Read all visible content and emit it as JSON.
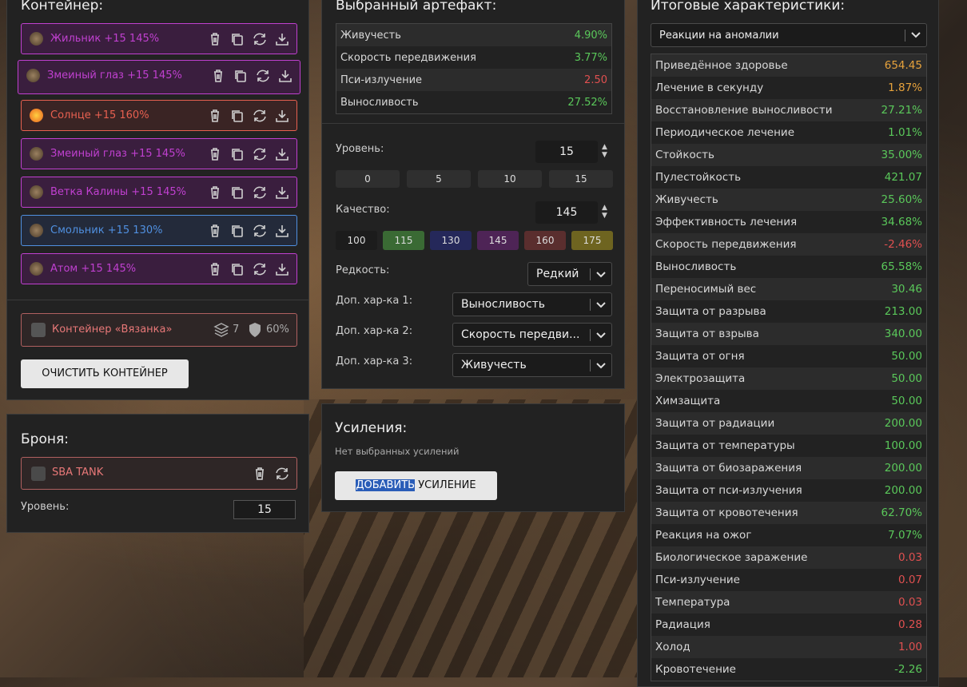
{
  "container": {
    "title": "Контейнер:",
    "artifacts": [
      {
        "name": "Жильник +15 145%",
        "color": "#c040d0",
        "icon": "artifact-icon"
      },
      {
        "name": "Змеиный глаз +15 145%",
        "color": "#c040d0",
        "icon": "artifact-icon"
      },
      {
        "name": "Солнце +15 160%",
        "color": "#e86050",
        "icon": "artifact-icon"
      },
      {
        "name": "Змеиный глаз +15 145%",
        "color": "#c040d0",
        "icon": "artifact-icon"
      },
      {
        "name": "Ветка Калины +15 145%",
        "color": "#c040d0",
        "icon": "artifact-icon"
      },
      {
        "name": "Смольник +15 130%",
        "color": "#5090e0",
        "icon": "artifact-icon"
      },
      {
        "name": "Атом +15 145%",
        "color": "#c040d0",
        "icon": "artifact-icon"
      }
    ],
    "box_name": "Контейнер «Вязанка»",
    "box_slots": "7",
    "box_protection": "60%",
    "clear_button": "ОЧИСТИТЬ КОНТЕЙНЕР"
  },
  "armor": {
    "title": "Броня:",
    "name": "SBA TANK",
    "level_label": "Уровень:",
    "level_value": "15"
  },
  "artifact": {
    "title": "Выбранный артефакт:",
    "stats": [
      {
        "label": "Живучесть",
        "value": "4.90%",
        "tone": "g"
      },
      {
        "label": "Скорость передвижения",
        "value": "3.77%",
        "tone": "g"
      },
      {
        "label": "Пси-излучение",
        "value": "2.50",
        "tone": "r"
      },
      {
        "label": "Выносливость",
        "value": "27.52%",
        "tone": "g"
      }
    ],
    "level_label": "Уровень:",
    "level_value": "15",
    "level_presets": [
      "0",
      "5",
      "10",
      "15"
    ],
    "quality_label": "Качество:",
    "quality_value": "145",
    "quality_presets": [
      {
        "label": "100",
        "color": "#1c1c1c"
      },
      {
        "label": "115",
        "color": "#3a6a34"
      },
      {
        "label": "130",
        "color": "#25285a"
      },
      {
        "label": "145",
        "color": "#4e2456"
      },
      {
        "label": "160",
        "color": "#5a2e2e"
      },
      {
        "label": "175",
        "color": "#6e6420"
      }
    ],
    "rarity_label": "Редкость:",
    "rarity_value": "Редкий",
    "extra1_label": "Доп. хар-ка 1:",
    "extra1_value": "Выносливость",
    "extra2_label": "Доп. хар-ка 2:",
    "extra2_value": "Скорость передви...",
    "extra3_label": "Доп. хар-ка 3:",
    "extra3_value": "Живучесть"
  },
  "boosts": {
    "title": "Усиления:",
    "empty_text": "Нет выбранных усилений",
    "add_button_highlight": "ДОБАВИТЬ",
    "add_button_rest": " УСИЛЕНИЕ"
  },
  "totals": {
    "title": "Итоговые характеристики:",
    "filter_value": "Реакции на аномалии",
    "rows": [
      {
        "label": "Приведённое здоровье",
        "value": "654.45",
        "tone": "o"
      },
      {
        "label": "Лечение в секунду",
        "value": "1.87%",
        "tone": "o"
      },
      {
        "label": "Восстановление выносливости",
        "value": "27.21%",
        "tone": "g"
      },
      {
        "label": "Периодическое лечение",
        "value": "1.01%",
        "tone": "g"
      },
      {
        "label": "Стойкость",
        "value": "35.00%",
        "tone": "g"
      },
      {
        "label": "Пулестойкость",
        "value": "421.07",
        "tone": "g"
      },
      {
        "label": "Живучесть",
        "value": "25.60%",
        "tone": "g"
      },
      {
        "label": "Эффективность лечения",
        "value": "34.68%",
        "tone": "g"
      },
      {
        "label": "Скорость передвижения",
        "value": "-2.46%",
        "tone": "r"
      },
      {
        "label": "Выносливость",
        "value": "65.58%",
        "tone": "g"
      },
      {
        "label": "Переносимый вес",
        "value": "30.46",
        "tone": "g"
      },
      {
        "label": "Защита от разрыва",
        "value": "213.00",
        "tone": "g"
      },
      {
        "label": "Защита от взрыва",
        "value": "340.00",
        "tone": "g"
      },
      {
        "label": "Защита от огня",
        "value": "50.00",
        "tone": "g"
      },
      {
        "label": "Электрозащита",
        "value": "50.00",
        "tone": "g"
      },
      {
        "label": "Химзащита",
        "value": "50.00",
        "tone": "g"
      },
      {
        "label": "Защита от радиации",
        "value": "200.00",
        "tone": "g"
      },
      {
        "label": "Защита от температуры",
        "value": "100.00",
        "tone": "g"
      },
      {
        "label": "Защита от биозаражения",
        "value": "200.00",
        "tone": "g"
      },
      {
        "label": "Защита от пси-излучения",
        "value": "200.00",
        "tone": "g"
      },
      {
        "label": "Защита от кровотечения",
        "value": "62.70%",
        "tone": "g"
      },
      {
        "label": "Реакция на ожог",
        "value": "7.07%",
        "tone": "g"
      },
      {
        "label": "Биологическое заражение",
        "value": "0.03",
        "tone": "r"
      },
      {
        "label": "Пси-излучение",
        "value": "0.07",
        "tone": "r"
      },
      {
        "label": "Температура",
        "value": "0.03",
        "tone": "r"
      },
      {
        "label": "Радиация",
        "value": "0.28",
        "tone": "r"
      },
      {
        "label": "Холод",
        "value": "1.00",
        "tone": "r"
      },
      {
        "label": "Кровотечение",
        "value": "-2.26",
        "tone": "g"
      }
    ]
  }
}
